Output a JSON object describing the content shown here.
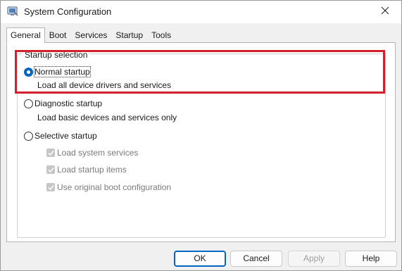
{
  "window": {
    "title": "System Configuration",
    "icon": "msconfig-app-icon",
    "close_icon": "close-icon"
  },
  "tabs": [
    {
      "label": "General",
      "active": true
    },
    {
      "label": "Boot",
      "active": false
    },
    {
      "label": "Services",
      "active": false
    },
    {
      "label": "Startup",
      "active": false
    },
    {
      "label": "Tools",
      "active": false
    }
  ],
  "startup_selection": {
    "legend": "Startup selection",
    "options": [
      {
        "label": "Normal startup",
        "description": "Load all device drivers and services",
        "checked": true
      },
      {
        "label": "Diagnostic startup",
        "description": "Load basic devices and services only",
        "checked": false
      },
      {
        "label": "Selective startup",
        "description": "",
        "checked": false
      }
    ],
    "selective_items": [
      {
        "label": "Load system services",
        "checked": true,
        "enabled": false
      },
      {
        "label": "Load startup items",
        "checked": true,
        "enabled": false
      },
      {
        "label": "Use original boot configuration",
        "checked": true,
        "enabled": false
      }
    ]
  },
  "buttons": {
    "ok": "OK",
    "cancel": "Cancel",
    "apply": "Apply",
    "help": "Help"
  },
  "colors": {
    "accent": "#0067c0",
    "highlight": "#d4202e"
  }
}
